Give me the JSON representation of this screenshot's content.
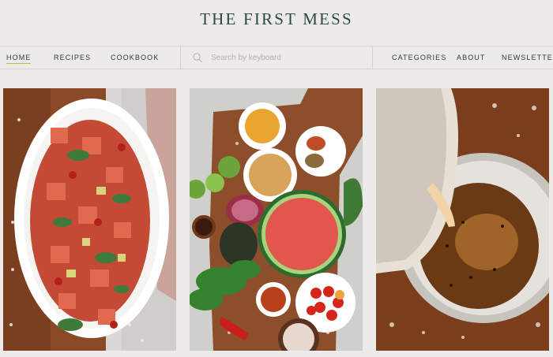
{
  "header": {
    "logo_text": "THE FIRST MESS"
  },
  "nav": {
    "left": [
      {
        "label": "HOME",
        "active": true
      },
      {
        "label": "RECIPES"
      },
      {
        "label": "COOKBOOK"
      }
    ],
    "search": {
      "placeholder": "Search by keyboard",
      "value": "",
      "icon": "search-icon"
    },
    "right": [
      {
        "label": "CATEGORIES"
      },
      {
        "label": "ABOUT"
      },
      {
        "label": "NEWSLETTER"
      }
    ]
  },
  "photos": [
    {
      "subject": "watermelon-salad-platter"
    },
    {
      "subject": "watermelon-ingredients-flatlay"
    },
    {
      "subject": "pouring-dressing-bowl"
    }
  ],
  "colors": {
    "accent_underline": "#c9b44a",
    "logo": "#2d4a41",
    "background": "#ecebea"
  }
}
